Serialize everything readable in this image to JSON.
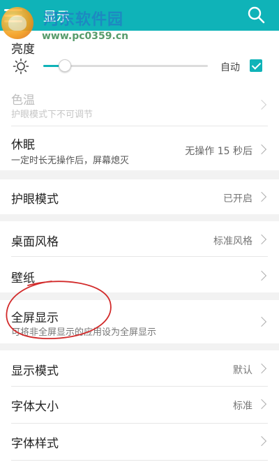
{
  "header": {
    "title": "显示",
    "menu_icon": "menu-icon",
    "search_icon": "search-icon",
    "background": "#0fb3b8"
  },
  "watermark": {
    "site_name": "河东软件园",
    "url": "www.pc0359.cn"
  },
  "brightness": {
    "label": "亮度",
    "auto_label": "自动",
    "auto_checked": true,
    "level_fraction": 0.13
  },
  "color_temp": {
    "label": "色温",
    "subtitle": "护眼模式下不可调节",
    "enabled": false
  },
  "sleep": {
    "label": "休眠",
    "subtitle": "一定时长无操作后，屏幕熄灭",
    "value": "无操作 15 秒后"
  },
  "eye_care": {
    "label": "护眼模式",
    "value": "已开启"
  },
  "desktop_style": {
    "label": "桌面风格",
    "value": "标准风格"
  },
  "wallpaper": {
    "label": "壁纸"
  },
  "fullscreen": {
    "label": "全屏显示",
    "subtitle": "可将非全屏显示的应用设为全屏显示"
  },
  "display_mode": {
    "label": "显示模式",
    "value": "默认"
  },
  "font_size": {
    "label": "字体大小",
    "value": "标准"
  },
  "font_style": {
    "label": "字体样式"
  },
  "accent_color": "#0fb3b8",
  "annotation_color": "#d22a2a"
}
